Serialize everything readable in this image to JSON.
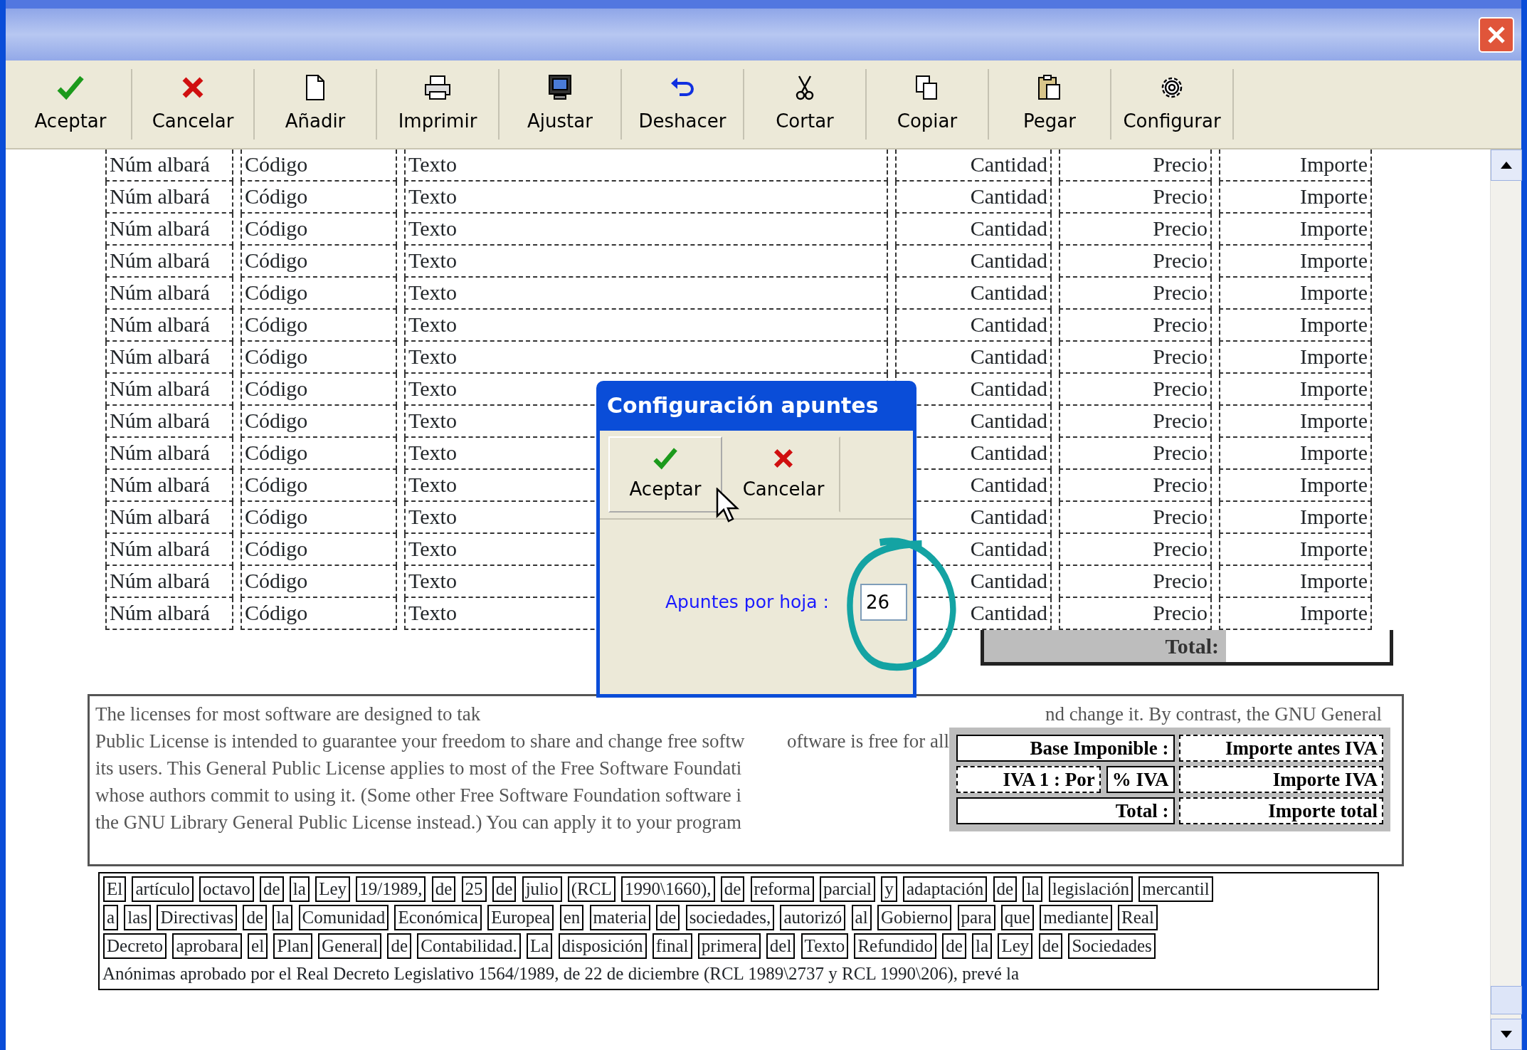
{
  "toolbar": [
    {
      "label": "Aceptar"
    },
    {
      "label": "Cancelar"
    },
    {
      "label": "Añadir"
    },
    {
      "label": "Imprimir"
    },
    {
      "label": "Ajustar"
    },
    {
      "label": "Deshacer"
    },
    {
      "label": "Cortar"
    },
    {
      "label": "Copiar"
    },
    {
      "label": "Pegar"
    },
    {
      "label": "Configurar"
    }
  ],
  "table": {
    "rows": [
      [
        "Núm albará",
        "Código",
        "Texto",
        "Cantidad",
        "Precio",
        "Importe"
      ],
      [
        "Núm albará",
        "Código",
        "Texto",
        "Cantidad",
        "Precio",
        "Importe"
      ],
      [
        "Núm albará",
        "Código",
        "Texto",
        "Cantidad",
        "Precio",
        "Importe"
      ],
      [
        "Núm albará",
        "Código",
        "Texto",
        "Cantidad",
        "Precio",
        "Importe"
      ],
      [
        "Núm albará",
        "Código",
        "Texto",
        "Cantidad",
        "Precio",
        "Importe"
      ],
      [
        "Núm albará",
        "Código",
        "Texto",
        "Cantidad",
        "Precio",
        "Importe"
      ],
      [
        "Núm albará",
        "Código",
        "Texto",
        "Cantidad",
        "Precio",
        "Importe"
      ],
      [
        "Núm albará",
        "Código",
        "Texto",
        "Cantidad",
        "Precio",
        "Importe"
      ],
      [
        "Núm albará",
        "Código",
        "Texto",
        "Cantidad",
        "Precio",
        "Importe"
      ],
      [
        "Núm albará",
        "Código",
        "Texto",
        "Cantidad",
        "Precio",
        "Importe"
      ],
      [
        "Núm albará",
        "Código",
        "Texto",
        "Cantidad",
        "Precio",
        "Importe"
      ],
      [
        "Núm albará",
        "Código",
        "Texto",
        "Cantidad",
        "Precio",
        "Importe"
      ],
      [
        "Núm albará",
        "Código",
        "Texto",
        "Cantidad",
        "Precio",
        "Importe"
      ],
      [
        "Núm albará",
        "Código",
        "Texto",
        "Cantidad",
        "Precio",
        "Importe"
      ],
      [
        "Núm albará",
        "Código",
        "Texto",
        "Cantidad",
        "Precio",
        "Importe"
      ]
    ],
    "total_label": "Total:"
  },
  "license_lines": [
    {
      "left": "The licenses for most software are designed to tak",
      "right": "nd change it.  By contrast, the GNU General"
    },
    {
      "left": "Public License is intended to guarantee your freedom to share and change free softw",
      "right": "oftware is free for all"
    },
    {
      "left": "its users.  This General Public License applies to most of the Free Software Foundati"
    },
    {
      "left": "whose authors commit to using it.  (Some other Free Software Foundation software i"
    },
    {
      "left": "the GNU Library General Public License instead.)  You can apply it to your program"
    }
  ],
  "totals": [
    {
      "label": "Base Imponible :",
      "value": "Importe antes IVA"
    },
    {
      "label": "IVA 1 : Por",
      "extra": "% IVA",
      "value": "Importe IVA"
    },
    {
      "label": "Total :",
      "value": "Importe total"
    }
  ],
  "paragraph": [
    {
      "text": "El artículo octavo de la Ley 19/1989, de 25 de julio (RCL 1990\\1660), de reforma parcial y adaptación de la legislación mercantil",
      "boxed": true
    },
    {
      "text": "a las Directivas de la Comunidad Económica Europea en materia de sociedades, autorizó al Gobierno para que mediante Real",
      "boxed": true
    },
    {
      "text": "Decreto aprobara el Plan General de Contabilidad. La disposición final primera del Texto Refundido de la Ley de Sociedades",
      "boxed": true
    },
    {
      "text": "Anónimas aprobado por el Real Decreto Legislativo 1564/1989, de 22 de diciembre (RCL 1989\\2737 y RCL 1990\\206), prevé la",
      "boxed": false
    }
  ],
  "dialog": {
    "title": "Configuración apuntes",
    "buttons": [
      {
        "label": "Aceptar",
        "hovered": true
      },
      {
        "label": "Cancelar",
        "hovered": false
      }
    ],
    "field_label": "Apuntes por hoja :",
    "value": "26"
  }
}
